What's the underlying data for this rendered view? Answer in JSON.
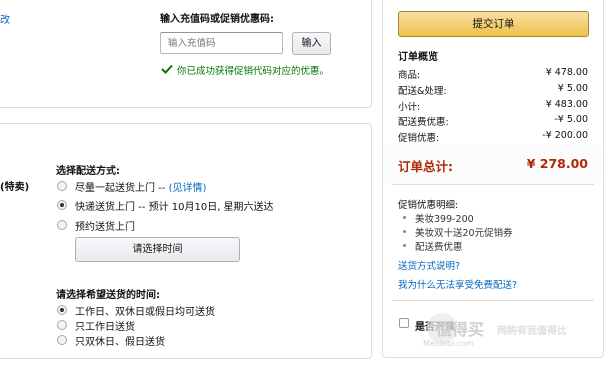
{
  "gift_code": {
    "edit_fragment": "改",
    "title": "输入充值码或促销优惠码:",
    "placeholder": "输入充值码",
    "apply_label": "输入",
    "success_message": "你已成功获得促销代码对应的优惠。"
  },
  "shipping": {
    "left_fragment": "(特卖)",
    "method_title": "选择配送方式:",
    "options": [
      {
        "label": "尽量一起送货上门 -- ",
        "link": "(见详情)",
        "selected": false
      },
      {
        "label": "快递送货上门 --  预计 10月10日, 星期六送达",
        "selected": true
      },
      {
        "label": "预约送货上门",
        "selected": false
      }
    ],
    "time_button": "请选择时间",
    "time_title": "请选择希望送货的时间:",
    "time_options": [
      {
        "label": "工作日、双休日或假日均可送货",
        "selected": true
      },
      {
        "label": "只工作日送货",
        "selected": false
      },
      {
        "label": "只双休日、假日送货",
        "selected": false
      }
    ]
  },
  "summary": {
    "submit_label": "提交订单",
    "title": "订单概览",
    "rows": [
      {
        "label": "商品:",
        "value": "¥ 478.00"
      },
      {
        "label": "配送&处理:",
        "value": "¥ 5.00"
      },
      {
        "label": "小计:",
        "value": "¥ 483.00"
      },
      {
        "label": "配送费优惠:",
        "value": "-¥ 5.00"
      },
      {
        "label": "促销优惠:",
        "value": "-¥ 200.00"
      }
    ],
    "total_label": "订单总计:",
    "total_value": "¥ 278.00",
    "promo_title": "促销优惠明细:",
    "promo_items": [
      "美妆399-200",
      "美妆双十送20元促销券",
      "配送费优惠"
    ],
    "links": [
      "送货方式说明?",
      "我为什么无法享受免费配送?"
    ],
    "gift_checkbox_label": "是否开具"
  },
  "watermark": {
    "cn": "值得买",
    "domain": "Meidebi.com",
    "tagline": "网购有我值得比"
  },
  "colors": {
    "link": "#0066c0",
    "success": "#007600",
    "total": "#b12704",
    "submit_button": "#f0c14b"
  }
}
